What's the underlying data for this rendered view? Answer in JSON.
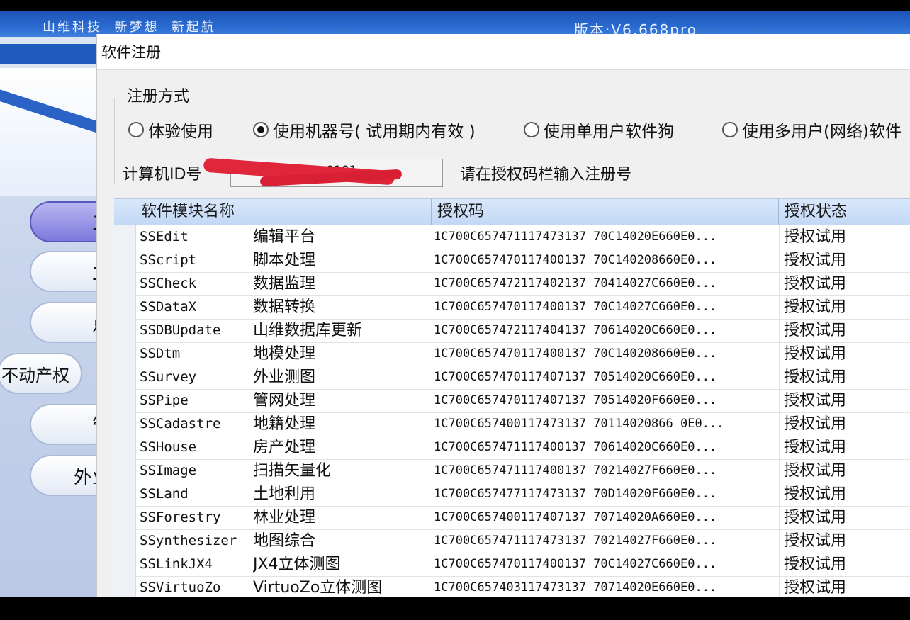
{
  "app": {
    "slogan": "山维科技  新梦想  新起航",
    "version": "版本·V6.668pro",
    "side_buttons": [
      "三",
      "立",
      "点",
      "不动产权",
      "管",
      "外业"
    ]
  },
  "dialog": {
    "title": "软件注册",
    "group_label": "注册方式",
    "radios": [
      {
        "label": "体验使用",
        "checked": false
      },
      {
        "label": "使用机器号( 试用期内有效 )",
        "checked": true
      },
      {
        "label": "使用单用户软件狗",
        "checked": false
      },
      {
        "label": "使用多用户(网络)软件",
        "checked": false
      }
    ],
    "computer_id_label": "计算机ID号",
    "computer_id_value": "7163 · · · · · · · 9191",
    "hint": "请在授权码栏输入注册号",
    "columns": [
      "软件模块名称",
      "授权码",
      "授权状态"
    ],
    "rows": [
      {
        "code": "SSEdit",
        "name": "编辑平台",
        "auth": "1C700C657471117473137 70C14020E660E0...",
        "status": "授权试用"
      },
      {
        "code": "SScript",
        "name": "脚本处理",
        "auth": "1C700C657470117400137 70C140208660E0...",
        "status": "授权试用"
      },
      {
        "code": "SSCheck",
        "name": "数据监理",
        "auth": "1C700C657472117402137 70414027C660E0...",
        "status": "授权试用"
      },
      {
        "code": "SSDataX",
        "name": "数据转换",
        "auth": "1C700C657470117400137 70C14027C660E0...",
        "status": "授权试用"
      },
      {
        "code": "SSDBUpdate",
        "name": "山维数据库更新",
        "auth": "1C700C657472117404137 70614020C660E0...",
        "status": "授权试用"
      },
      {
        "code": "SSDtm",
        "name": "地模处理",
        "auth": "1C700C657470117400137 70C140208660E0...",
        "status": "授权试用"
      },
      {
        "code": "SSurvey",
        "name": "外业测图",
        "auth": "1C700C657470117407137 70514020C660E0...",
        "status": "授权试用"
      },
      {
        "code": "SSPipe",
        "name": "管网处理",
        "auth": "1C700C657470117407137 70514020F660E0...",
        "status": "授权试用"
      },
      {
        "code": "SSCadastre",
        "name": "地籍处理",
        "auth": "1C700C657400117473137 70114020866 0E0...",
        "status": "授权试用"
      },
      {
        "code": "SSHouse",
        "name": "房产处理",
        "auth": "1C700C657471117400137 70614020C660E0...",
        "status": "授权试用"
      },
      {
        "code": "SSImage",
        "name": "扫描矢量化",
        "auth": "1C700C657471117400137 70214027F660E0...",
        "status": "授权试用"
      },
      {
        "code": "SSLand",
        "name": "土地利用",
        "auth": "1C700C657477117473137 70D14020F660E0...",
        "status": "授权试用"
      },
      {
        "code": "SSForestry",
        "name": "林业处理",
        "auth": "1C700C657400117407137 70714020A660E0...",
        "status": "授权试用"
      },
      {
        "code": "SSynthesizer",
        "name": "地图综合",
        "auth": "1C700C657471117473137 70214027F660E0...",
        "status": "授权试用"
      },
      {
        "code": "SSLinkJX4",
        "name": "JX4立体测图",
        "auth": "1C700C657470117400137 70C14027C660E0...",
        "status": "授权试用"
      },
      {
        "code": "SSVirtuoZo",
        "name": "VirtuoZo立体测图",
        "auth": "1C700C657403117473137 70714020E660E0...",
        "status": "授权试用"
      }
    ]
  }
}
